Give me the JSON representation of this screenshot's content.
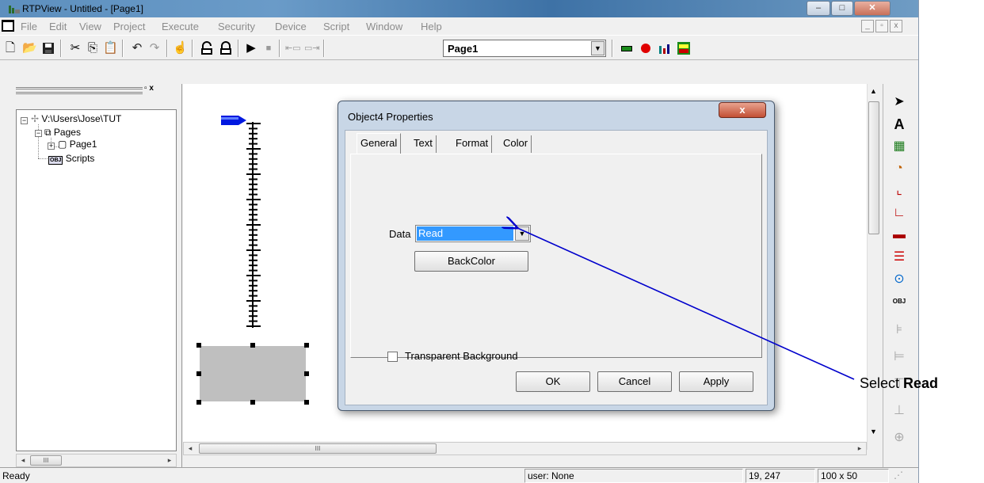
{
  "window": {
    "title": "RTPView  -  Untitled - [Page1]",
    "minimize": "–",
    "maximize": "□",
    "close": "✕"
  },
  "menu": {
    "items": [
      "File",
      "Edit",
      "View",
      "Project",
      "Execute",
      "Security",
      "Device",
      "Script",
      "Window",
      "Help"
    ],
    "mdi": [
      "_",
      "▫",
      "x"
    ]
  },
  "toolbar": {
    "page_select": "Page1"
  },
  "tree": {
    "header_buttons": "▫ x",
    "root": "V:\\Users\\Jose\\TUT",
    "pages": "Pages",
    "page1": "Page1",
    "scripts": "Scripts",
    "scripts_badge": "OBJ",
    "scroll_thumb": "III"
  },
  "canvas": {
    "scroll_thumb": "III"
  },
  "dialog": {
    "title": "Object4 Properties",
    "close": "x",
    "tabs": [
      "General",
      "Text",
      "Format",
      "Color"
    ],
    "data_label": "Data",
    "data_value": "Read",
    "backcolor_button": "BackColor",
    "transparent_label": "Transparent Background",
    "ok": "OK",
    "cancel": "Cancel",
    "apply": "Apply"
  },
  "statusbar": {
    "ready": "Ready",
    "user": "user: None",
    "coords": "19, 247",
    "size": "100 x 50"
  },
  "annotation": {
    "prefix": "Select ",
    "bold": "Read",
    "arrow_color": "#0000cc"
  },
  "colors": {
    "selection": "#3399ff",
    "thermo_blue": "#0018e0",
    "widget_gray": "#bfbfbf"
  }
}
